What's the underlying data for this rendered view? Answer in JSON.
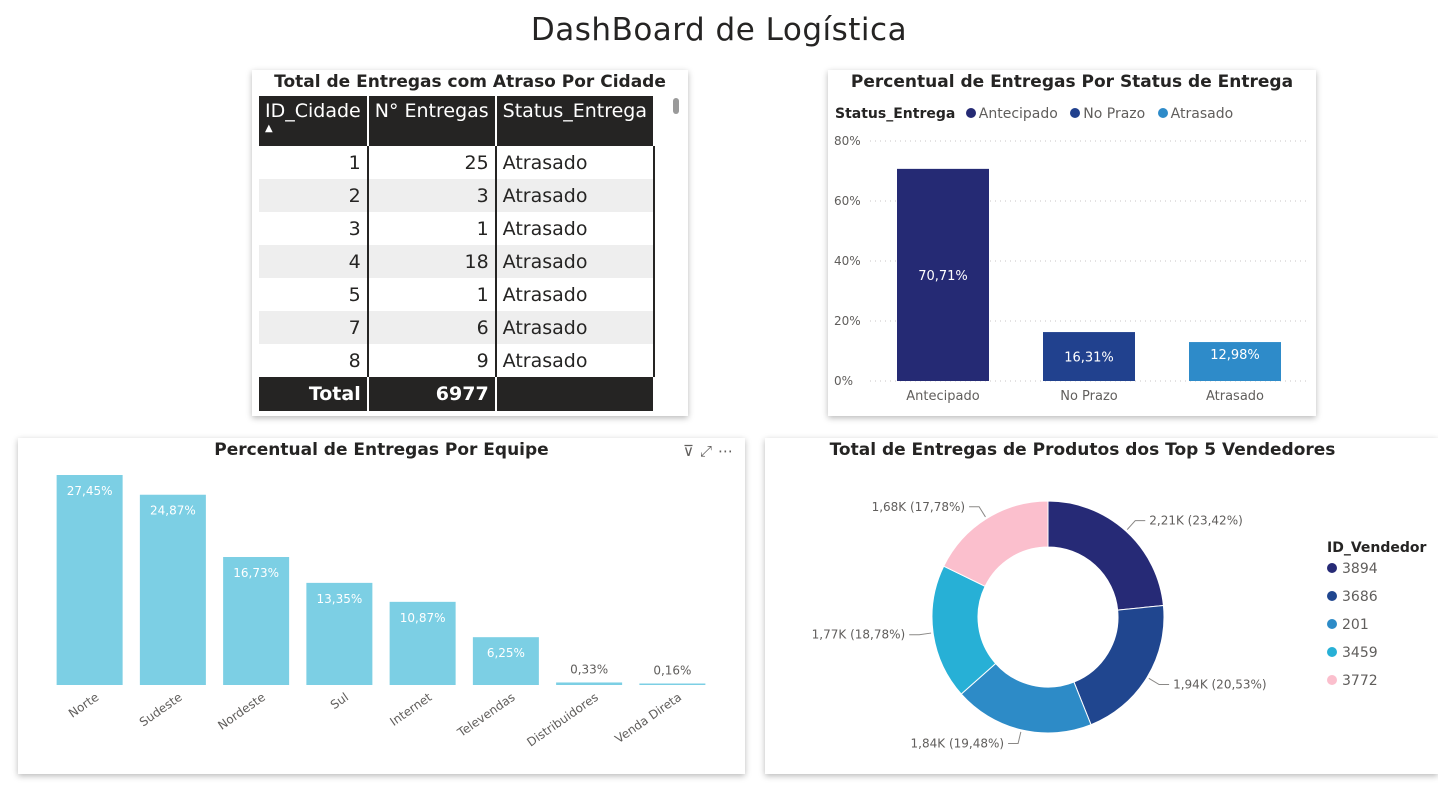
{
  "page": {
    "title": "DashBoard de Logística"
  },
  "table": {
    "title": "Total de Entregas com Atraso Por Cidade",
    "columns": [
      "ID_Cidade",
      "N° Entregas",
      "Status_Entrega"
    ],
    "rows": [
      [
        "1",
        "25",
        "Atrasado"
      ],
      [
        "2",
        "3",
        "Atrasado"
      ],
      [
        "3",
        "1",
        "Atrasado"
      ],
      [
        "4",
        "18",
        "Atrasado"
      ],
      [
        "5",
        "1",
        "Atrasado"
      ],
      [
        "7",
        "6",
        "Atrasado"
      ],
      [
        "8",
        "9",
        "Atrasado"
      ]
    ],
    "total": {
      "label": "Total",
      "value": "6977"
    }
  },
  "chart_data": [
    {
      "id": "status",
      "type": "bar",
      "title": "Percentual de Entregas Por Status de Entrega",
      "legend_title": "Status_Entrega",
      "categories": [
        "Antecipado",
        "No Prazo",
        "Atrasado"
      ],
      "values": [
        70.71,
        16.31,
        12.98
      ],
      "labels": [
        "70,71%",
        "16,31%",
        "12,98%"
      ],
      "colors": [
        "#252a74",
        "#21418e",
        "#2e8bc9"
      ],
      "yticks": [
        "0%",
        "20%",
        "40%",
        "60%",
        "80%"
      ],
      "ylim": [
        0,
        80
      ],
      "grid": true,
      "legend_position": "top-left"
    },
    {
      "id": "team",
      "type": "bar",
      "title": "Percentual de Entregas Por Equipe",
      "categories": [
        "Norte",
        "Sudeste",
        "Nordeste",
        "Sul",
        "Internet",
        "Televendas",
        "Distribuidores",
        "Venda Direta"
      ],
      "values": [
        27.45,
        24.87,
        16.73,
        13.35,
        10.87,
        6.25,
        0.33,
        0.16
      ],
      "labels": [
        "27,45%",
        "24,87%",
        "16,73%",
        "13,35%",
        "10,87%",
        "6,25%",
        "0,33%",
        "0,16%"
      ],
      "color": "#7ccfe4",
      "ylim": [
        0,
        27.45
      ]
    },
    {
      "id": "vendors",
      "type": "pie",
      "donut": true,
      "title": "Total de Entregas de Produtos dos Top 5 Vendedores",
      "legend_title": "ID_Vendedor",
      "legend_position": "right",
      "slices": [
        {
          "name": "3894",
          "value": 23.42,
          "label": "2,21K (23,42%)",
          "color": "#262a76"
        },
        {
          "name": "3686",
          "value": 20.53,
          "label": "1,94K (20,53%)",
          "color": "#20468f"
        },
        {
          "name": "201",
          "value": 19.48,
          "label": "1,84K (19,48%)",
          "color": "#2d8bc7"
        },
        {
          "name": "3459",
          "value": 18.78,
          "label": "1,77K (18,78%)",
          "color": "#27b0d6"
        },
        {
          "name": "3772",
          "value": 17.78,
          "label": "1,68K (17,78%)",
          "color": "#fbbfcd"
        }
      ]
    }
  ],
  "icons": [
    "filter-icon",
    "focus-mode-icon",
    "more-options-icon"
  ]
}
